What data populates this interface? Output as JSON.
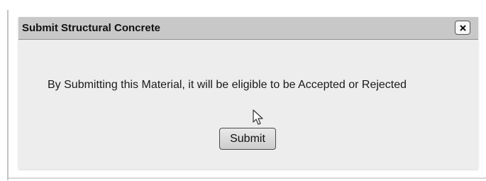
{
  "dialog": {
    "title": "Submit Structural Concrete",
    "close_icon": "close-icon",
    "message": "By Submitting this Material, it will be eligible to be Accepted or Rejected",
    "submit_label": "Submit"
  },
  "cursor": {
    "icon": "mouse-pointer-icon"
  },
  "colors": {
    "title_bar": "#c8c8c8",
    "dialog_body": "#ededed",
    "button": "#dcdcdc"
  }
}
